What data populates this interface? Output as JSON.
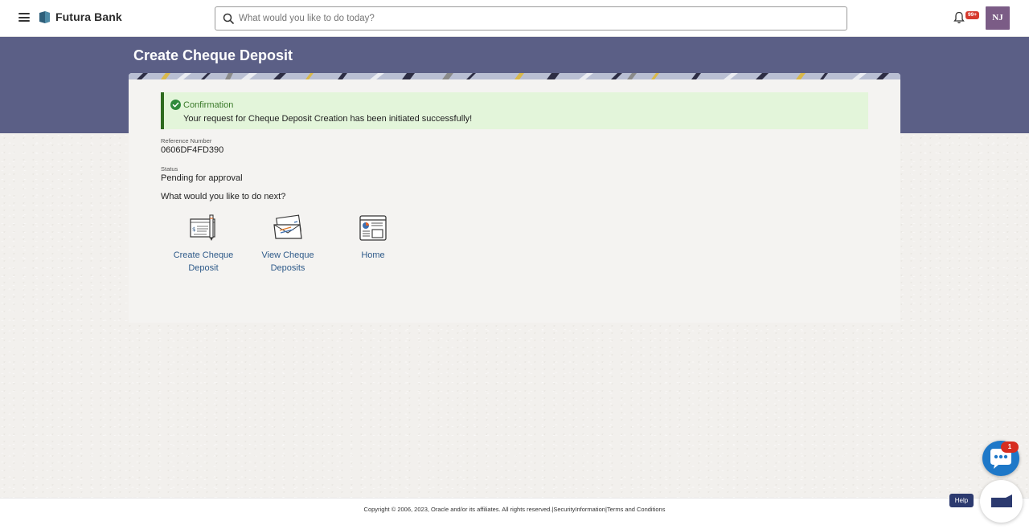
{
  "app": {
    "bank_name": "Futura Bank"
  },
  "header": {
    "search": {
      "placeholder": "What would you like to do today?",
      "value": ""
    },
    "notification_count": "99+",
    "avatar_initials": "NJ"
  },
  "page": {
    "title": "Create Cheque Deposit"
  },
  "confirmation": {
    "title": "Confirmation",
    "message": "Your request for Cheque Deposit Creation has been initiated successfully!"
  },
  "details": {
    "reference_label": "Reference Number",
    "reference_value": "0606DF4FD390",
    "status_label": "Status",
    "status_value": "Pending for approval"
  },
  "next": {
    "prompt": "What would you like to do next?",
    "actions": [
      {
        "label_line1": "Create Cheque",
        "label_line2": "Deposit",
        "icon": "cheque-pen-icon"
      },
      {
        "label_line1": "View Cheque",
        "label_line2": "Deposits",
        "icon": "cheque-envelope-icon"
      },
      {
        "label_line1": "Home",
        "label_line2": "",
        "icon": "dashboard-icon"
      }
    ]
  },
  "footer": {
    "copyright": "Copyright © 2006, 2023, Oracle and/or its affiliates. All rights reserved.",
    "link_security": "SecurityInformation",
    "link_terms": "Terms and Conditions"
  },
  "chat": {
    "badge_count": "1",
    "help_label": "Help"
  },
  "colors": {
    "banner": "#5b5f86",
    "confirmation_bg": "#e3f5da",
    "confirmation_border": "#2e6b1f",
    "link": "#2e5a89",
    "chat": "#1e78c8"
  }
}
